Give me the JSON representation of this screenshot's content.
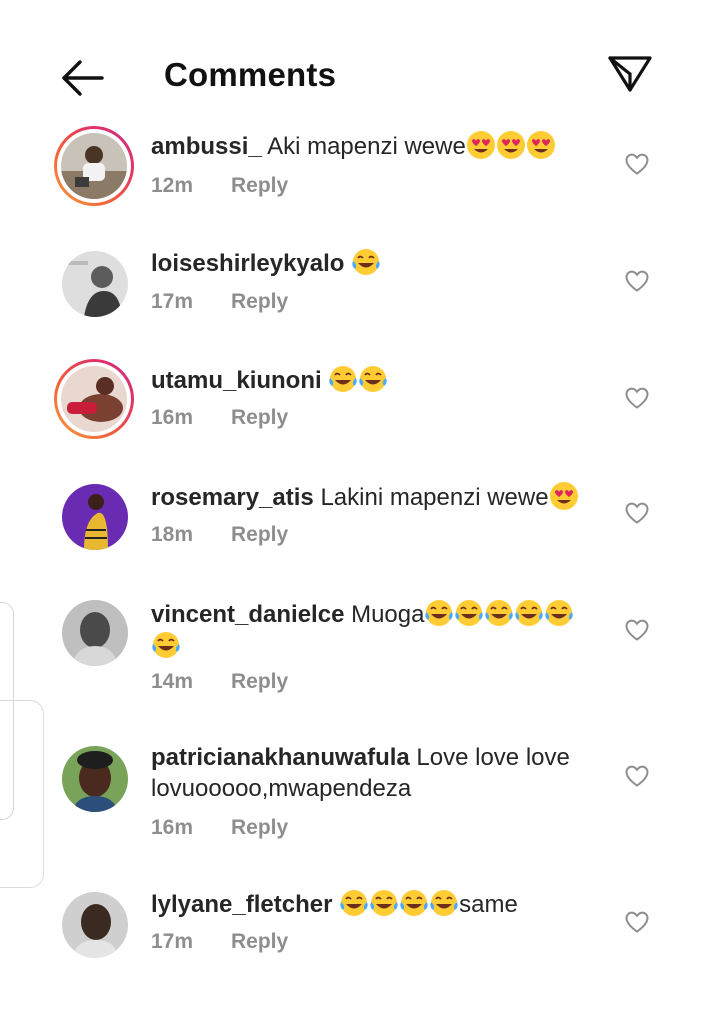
{
  "header": {
    "title": "Comments",
    "back_icon": "arrow-left-icon",
    "share_icon": "paper-plane-icon"
  },
  "colors": {
    "username": "#262626",
    "meta": "#8e8e8e",
    "story_ring_start": "#f9a03f",
    "story_ring_end": "#c13584"
  },
  "comments": [
    {
      "username": "ambussi_",
      "text": " Aki mapenzi wewe",
      "emoji": "heart-eyes",
      "emoji_count": 3,
      "time": "12m",
      "reply": "Reply",
      "story_ring": true
    },
    {
      "username": "loiseshirleykyalo",
      "text": " ",
      "emoji": "tears-of-joy",
      "emoji_count": 1,
      "time": "17m",
      "reply": "Reply",
      "story_ring": false
    },
    {
      "username": "utamu_kiunoni",
      "text": " ",
      "emoji": "tears-of-joy",
      "emoji_count": 2,
      "time": "16m",
      "reply": "Reply",
      "story_ring": true
    },
    {
      "username": "rosemary_atis",
      "text": " Lakini mapenzi wewe",
      "emoji": "heart-eyes",
      "emoji_count": 1,
      "time": "18m",
      "reply": "Reply",
      "story_ring": false
    },
    {
      "username": "vincent_danielce",
      "text": " Muoga",
      "emoji": "tears-of-joy",
      "emoji_count": 6,
      "time": "14m",
      "reply": "Reply",
      "story_ring": false
    },
    {
      "username": "patricianakhanuwafula",
      "text": " Love love love lovuooooo,mwapendeza",
      "emoji": "",
      "emoji_count": 0,
      "time": "16m",
      "reply": "Reply",
      "story_ring": false
    },
    {
      "username": "lylyane_fletcher",
      "text": " ",
      "emoji": "tears-of-joy",
      "emoji_count": 4,
      "trailing_text": "same",
      "time": "17m",
      "reply": "Reply",
      "story_ring": false
    }
  ]
}
